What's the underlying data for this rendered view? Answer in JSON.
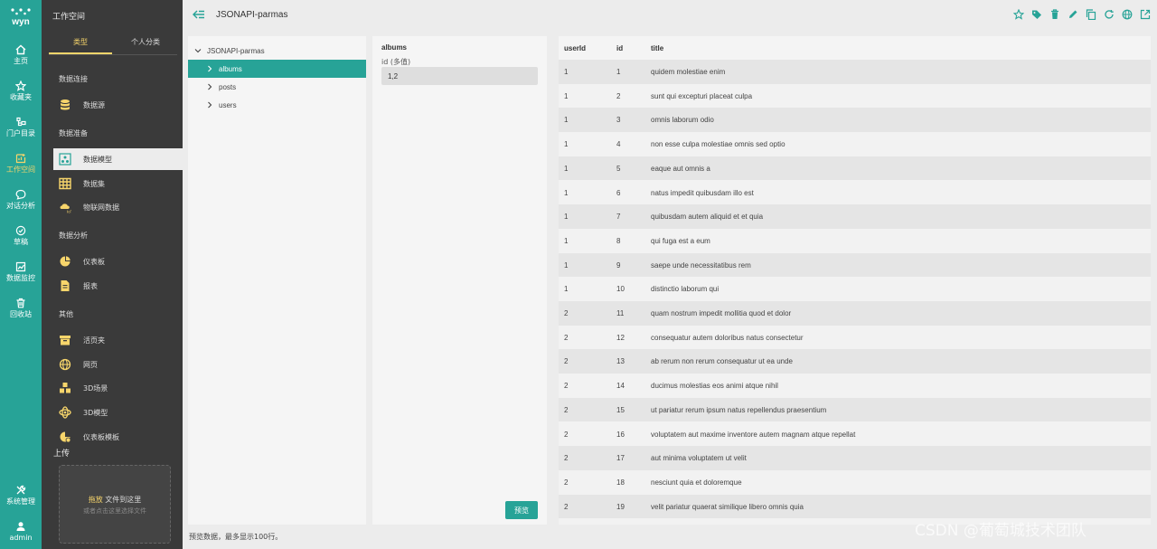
{
  "rail": {
    "logo_text": "wyn",
    "items": [
      {
        "label": "主页",
        "icon": "home-icon"
      },
      {
        "label": "收藏夹",
        "icon": "star-icon"
      },
      {
        "label": "门户目录",
        "icon": "portal-icon"
      },
      {
        "label": "工作空间",
        "icon": "workspace-icon"
      },
      {
        "label": "对话分析",
        "icon": "chat-icon"
      },
      {
        "label": "草稿",
        "icon": "draft-icon"
      },
      {
        "label": "数据监控",
        "icon": "monitor-icon"
      },
      {
        "label": "回收站",
        "icon": "trash-icon"
      },
      {
        "label": "系统管理",
        "icon": "tools-icon"
      },
      {
        "label": "admin",
        "icon": "user-icon"
      }
    ]
  },
  "nav": {
    "title": "工作空间",
    "tabs": [
      "类型",
      "个人分类"
    ],
    "sections": [
      "数据连接",
      "数据准备",
      "数据分析",
      "其他"
    ],
    "items": [
      {
        "label": "数据源",
        "icon": "database-icon"
      },
      {
        "label": "数据模型",
        "icon": "data-model-icon"
      },
      {
        "label": "数据集",
        "icon": "dataset-icon"
      },
      {
        "label": "物联网数据",
        "icon": "iot-icon"
      },
      {
        "label": "仪表板",
        "icon": "dashboard-icon"
      },
      {
        "label": "报表",
        "icon": "report-icon"
      },
      {
        "label": "活页夹",
        "icon": "binder-icon"
      },
      {
        "label": "网页",
        "icon": "web-icon"
      },
      {
        "label": "3D场景",
        "icon": "3d-scene-icon"
      },
      {
        "label": "3D模型",
        "icon": "3d-model-icon"
      },
      {
        "label": "仪表板模板",
        "icon": "dashboard-template-icon"
      }
    ],
    "upload_title": "上传",
    "upload_link": "拖放",
    "upload_text": " 文件到这里",
    "upload_hint": "或者点击这里选择文件"
  },
  "header": {
    "title": "JSONAPI-parmas",
    "tools": [
      "star-icon",
      "tag-icon",
      "delete-icon",
      "edit-icon",
      "copy-icon",
      "refresh-icon",
      "globe-icon",
      "open-external-icon"
    ]
  },
  "tree": {
    "root": "JSONAPI-parmas",
    "children": [
      "albums",
      "posts",
      "users"
    ]
  },
  "params": {
    "title": "albums",
    "label": "id (多值)",
    "value": "1,2",
    "button": "预览"
  },
  "table": {
    "columns": [
      "userId",
      "id",
      "title"
    ],
    "rows": [
      [
        "1",
        "1",
        "quidem molestiae enim"
      ],
      [
        "1",
        "2",
        "sunt qui excepturi placeat culpa"
      ],
      [
        "1",
        "3",
        "omnis laborum odio"
      ],
      [
        "1",
        "4",
        "non esse culpa molestiae omnis sed optio"
      ],
      [
        "1",
        "5",
        "eaque aut omnis a"
      ],
      [
        "1",
        "6",
        "natus impedit quibusdam illo est"
      ],
      [
        "1",
        "7",
        "quibusdam autem aliquid et et quia"
      ],
      [
        "1",
        "8",
        "qui fuga est a eum"
      ],
      [
        "1",
        "9",
        "saepe unde necessitatibus rem"
      ],
      [
        "1",
        "10",
        "distinctio laborum qui"
      ],
      [
        "2",
        "11",
        "quam nostrum impedit mollitia quod et dolor"
      ],
      [
        "2",
        "12",
        "consequatur autem doloribus natus consectetur"
      ],
      [
        "2",
        "13",
        "ab rerum non rerum consequatur ut ea unde"
      ],
      [
        "2",
        "14",
        "ducimus molestias eos animi atque nihil"
      ],
      [
        "2",
        "15",
        "ut pariatur rerum ipsum natus repellendus praesentium"
      ],
      [
        "2",
        "16",
        "voluptatem aut maxime inventore autem magnam atque repellat"
      ],
      [
        "2",
        "17",
        "aut minima voluptatem ut velit"
      ],
      [
        "2",
        "18",
        "nesciunt quia et doloremque"
      ],
      [
        "2",
        "19",
        "velit pariatur quaerat similique libero omnis quia"
      ]
    ]
  },
  "footer": "预览数据，最多显示100行。",
  "watermark": "CSDN @葡萄城技术团队",
  "colors": {
    "accent": "#27a397",
    "highlight": "#f7d56b",
    "nav_bg": "#3a3a3a"
  }
}
